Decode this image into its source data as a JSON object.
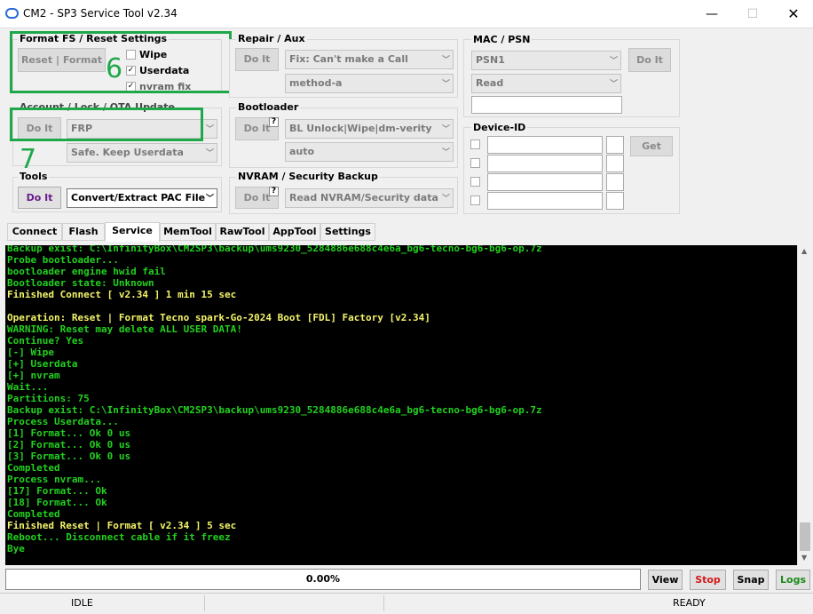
{
  "window": {
    "title": "CM2 - SP3 Service Tool v2.34",
    "min": "—",
    "max": "☐",
    "close": "✕"
  },
  "format": {
    "group": "Format FS / Reset Settings",
    "button": "Reset | Format",
    "wipe": "Wipe",
    "userdata": "Userdata",
    "nvram": "nvram fix"
  },
  "annotations": {
    "six": "6",
    "seven": "7"
  },
  "account": {
    "group": "Account / Lock / OTA Update",
    "button": "Do It",
    "combo1": "FRP",
    "combo2": "Safe. Keep Userdata"
  },
  "tools": {
    "group": "Tools",
    "button": "Do It",
    "combo": "Convert/Extract PAC File"
  },
  "repair": {
    "group": "Repair / Aux",
    "button": "Do It",
    "combo1": "Fix: Can't make a Call",
    "combo2": "method-a"
  },
  "bootloader": {
    "group": "Bootloader",
    "button": "Do It",
    "help": "?",
    "combo1": "BL Unlock|Wipe|dm-verity",
    "combo2": "auto"
  },
  "nvram": {
    "group": "NVRAM / Security Backup",
    "button": "Do It",
    "help": "?",
    "combo": "Read NVRAM/Security data"
  },
  "mac": {
    "group": "MAC / PSN",
    "combo1": "PSN1",
    "combo2": "Read",
    "button": "Do It"
  },
  "device": {
    "group": "Device-ID",
    "button": "Get"
  },
  "tabs": [
    "Connect",
    "Flash",
    "Service",
    "MemTool",
    "RawTool",
    "AppTool",
    "Settings"
  ],
  "log": [
    {
      "t": "Backup exist: C:\\InfinityBox\\CM2SP3\\backup\\ums9230_5284886e688c4e6a_bg6-tecno-bg6-bg6-op.7z",
      "c": "#22d11f"
    },
    {
      "t": "Probe bootloader...",
      "c": "#22d11f"
    },
    {
      "t": "bootloader engine hwid fail",
      "c": "#22d11f"
    },
    {
      "t": "Bootloader state: Unknown",
      "c": "#22d11f"
    },
    {
      "t": "Finished Connect [ v2.34 ] 1 min 15 sec",
      "c": "#f4f46a"
    },
    {
      "t": "",
      "c": "#22d11f"
    },
    {
      "t": "Operation: Reset | Format Tecno spark-Go-2024 Boot [FDL] Factory [v2.34]",
      "c": "#f4f46a"
    },
    {
      "t": "WARNING: Reset may delete ALL USER DATA!",
      "c": "#22d11f"
    },
    {
      "t": "Continue? Yes",
      "c": "#22d11f"
    },
    {
      "t": "[-] Wipe",
      "c": "#22d11f"
    },
    {
      "t": "[+] Userdata",
      "c": "#22d11f"
    },
    {
      "t": "[+] nvram",
      "c": "#22d11f"
    },
    {
      "t": "Wait...",
      "c": "#22d11f"
    },
    {
      "t": "Partitions: 75",
      "c": "#22d11f"
    },
    {
      "t": "Backup exist: C:\\InfinityBox\\CM2SP3\\backup\\ums9230_5284886e688c4e6a_bg6-tecno-bg6-bg6-op.7z",
      "c": "#22d11f"
    },
    {
      "t": "Process Userdata...",
      "c": "#22d11f"
    },
    {
      "t": "[1] Format... Ok 0 us",
      "c": "#22d11f"
    },
    {
      "t": "[2] Format... Ok 0 us",
      "c": "#22d11f"
    },
    {
      "t": "[3] Format... Ok 0 us",
      "c": "#22d11f"
    },
    {
      "t": "Completed",
      "c": "#22d11f"
    },
    {
      "t": "Process nvram...",
      "c": "#22d11f"
    },
    {
      "t": "[17] Format... Ok",
      "c": "#22d11f"
    },
    {
      "t": "[18] Format... Ok",
      "c": "#22d11f"
    },
    {
      "t": "Completed",
      "c": "#22d11f"
    },
    {
      "t": "Finished Reset | Format [ v2.34 ] 5 sec",
      "c": "#f4f46a"
    },
    {
      "t": "Reboot... Disconnect cable if it freez",
      "c": "#22d11f"
    },
    {
      "t": "Bye",
      "c": "#22d11f"
    }
  ],
  "progress": {
    "text": "0.00%",
    "value": 0
  },
  "actions": {
    "view": "View",
    "stop": "Stop",
    "snap": "Snap",
    "logs": "Logs"
  },
  "status": {
    "left": "IDLE",
    "right": "READY"
  },
  "colors": {
    "log_green": "#22d11f",
    "log_yellow": "#f4f46a",
    "annotation": "#1fa84a",
    "stop": "#d11a1a"
  }
}
